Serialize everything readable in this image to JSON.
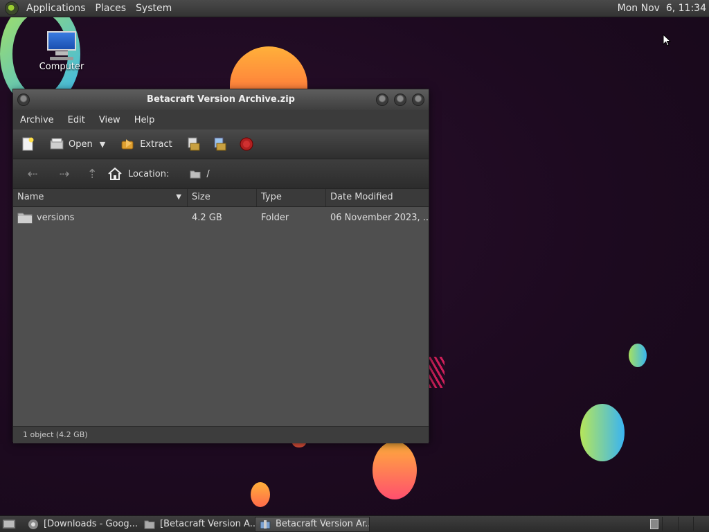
{
  "top_panel": {
    "menus": [
      "Applications",
      "Places",
      "System"
    ],
    "clock": "Mon Nov  6, 11:34"
  },
  "desktop": {
    "icons": [
      {
        "label": "Computer",
        "icon": "computer-icon"
      }
    ]
  },
  "window": {
    "title": "Betacraft Version Archive.zip",
    "menu": [
      "Archive",
      "Edit",
      "View",
      "Help"
    ],
    "toolbar": {
      "open_label": "Open",
      "extract_label": "Extract"
    },
    "location": {
      "label": "Location:",
      "path": "/"
    },
    "columns": [
      "Name",
      "Size",
      "Type",
      "Date Modified"
    ],
    "rows": [
      {
        "name": "versions",
        "size": "4.2 GB",
        "type": "Folder",
        "date": "06 November 2023, ..."
      }
    ],
    "status": "1 object (4.2 GB)"
  },
  "taskbar": {
    "tasks": [
      {
        "label": "[Downloads - Goog...",
        "icon": "chrome-icon"
      },
      {
        "label": "[Betacraft Version A...",
        "icon": "folder-icon"
      },
      {
        "label": "Betacraft Version Ar...",
        "icon": "archive-icon",
        "active": true
      }
    ]
  },
  "colors": {
    "accent_ring_start": "#a6e060",
    "accent_ring_end": "#38b6f0",
    "blob_orange": "#ff8a3c",
    "blob_pink": "#ff4f6e"
  }
}
